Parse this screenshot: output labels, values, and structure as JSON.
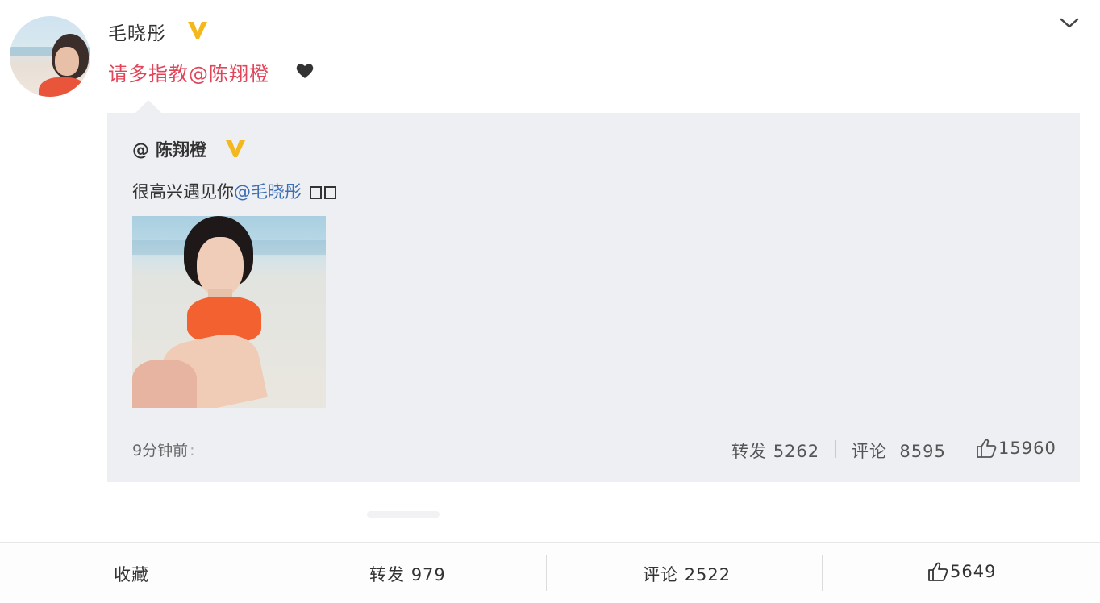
{
  "post": {
    "username": "毛晓彤",
    "text": "请多指教@陈翔橙",
    "verified_color": "#f2b81d",
    "text_color": "#e0455a"
  },
  "repost": {
    "author_prefix": "@",
    "author": "陈翔橙",
    "text_prefix": "很高兴遇见你",
    "text_mention": "@毛晓彤",
    "time": "9分钟前",
    "time_suffix": ":",
    "repost_label": "转发",
    "repost_count": "5262",
    "comment_label": "评论",
    "comment_count": "8595",
    "like_count": "15960",
    "mention_color": "#3c6eb4"
  },
  "bottom_bar": {
    "favorite_label": "收藏",
    "repost_label": "转发",
    "repost_count": "979",
    "comment_label": "评论",
    "comment_count": "2522",
    "like_count": "5649"
  },
  "icons": [
    "avatar",
    "verified-icon",
    "chevron-down-icon",
    "heart-icon",
    "thumbs-up-icon"
  ]
}
